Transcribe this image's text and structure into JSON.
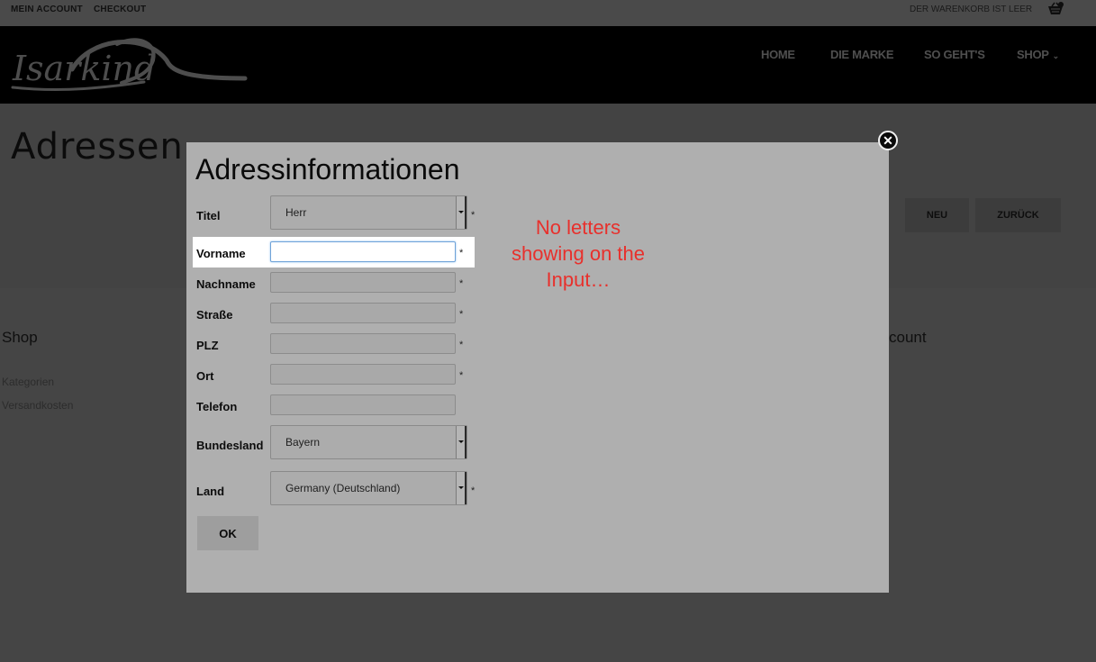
{
  "topbar": {
    "my_account": "MEIN ACCOUNT",
    "checkout": "CHECKOUT",
    "cart_status": "DER WARENKORB IST LEER",
    "cart_icon": "basket-icon"
  },
  "header": {
    "logo_text": "Isarkind",
    "nav": {
      "home": "HOME",
      "brand": "DIE MARKE",
      "howto": "SO GEHT'S",
      "shop": "SHOP",
      "shop_caret": "⌄"
    }
  },
  "page": {
    "title": "Adressen",
    "new_button": "NEU",
    "back_button": "ZURÜCK"
  },
  "footer": {
    "shop_heading": "Shop",
    "account_heading": "count",
    "links": [
      "Kategorien",
      "Versandkosten"
    ]
  },
  "modal": {
    "title": "Adressinformationen",
    "close_glyph": "✕",
    "required_mark": "*",
    "fields": {
      "titel": {
        "label": "Titel",
        "value": "Herr"
      },
      "vorname": {
        "label": "Vorname",
        "value": ""
      },
      "nachname": {
        "label": "Nachname",
        "value": ""
      },
      "strasse": {
        "label": "Straße",
        "value": ""
      },
      "plz": {
        "label": "PLZ",
        "value": ""
      },
      "ort": {
        "label": "Ort",
        "value": ""
      },
      "telefon": {
        "label": "Telefon",
        "value": ""
      },
      "bundesland": {
        "label": "Bundesland",
        "value": "Bayern"
      },
      "land": {
        "label": "Land",
        "value": "Germany (Deutschland)"
      }
    },
    "ok_button": "OK",
    "annotation": "No letters showing on the Input…"
  },
  "colors": {
    "overlay_bg": "#434343",
    "modal_bg": "#afafaf",
    "annotation": "#e8302c",
    "focus_border": "#6fa3d8"
  }
}
